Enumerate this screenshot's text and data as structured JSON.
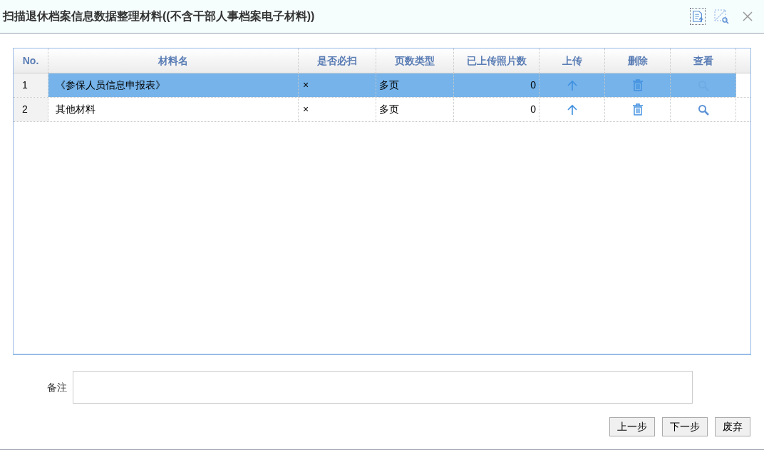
{
  "window": {
    "title": "扫描退休档案信息数据整理材料((不含干部人事档案电子材料))"
  },
  "table": {
    "columns": [
      "No.",
      "材料名",
      "是否必扫",
      "页数类型",
      "已上传照片数",
      "上传",
      "删除",
      "查看"
    ],
    "rows": [
      {
        "no": "1",
        "name": "《参保人员信息申报表》",
        "required": "×",
        "page_type": "多页",
        "uploaded": "0",
        "selected": true
      },
      {
        "no": "2",
        "name": "其他材料",
        "required": "×",
        "page_type": "多页",
        "uploaded": "0",
        "selected": false
      }
    ]
  },
  "remark": {
    "label": "备注"
  },
  "buttons": [
    "上一步",
    "下一步",
    "废弃"
  ]
}
